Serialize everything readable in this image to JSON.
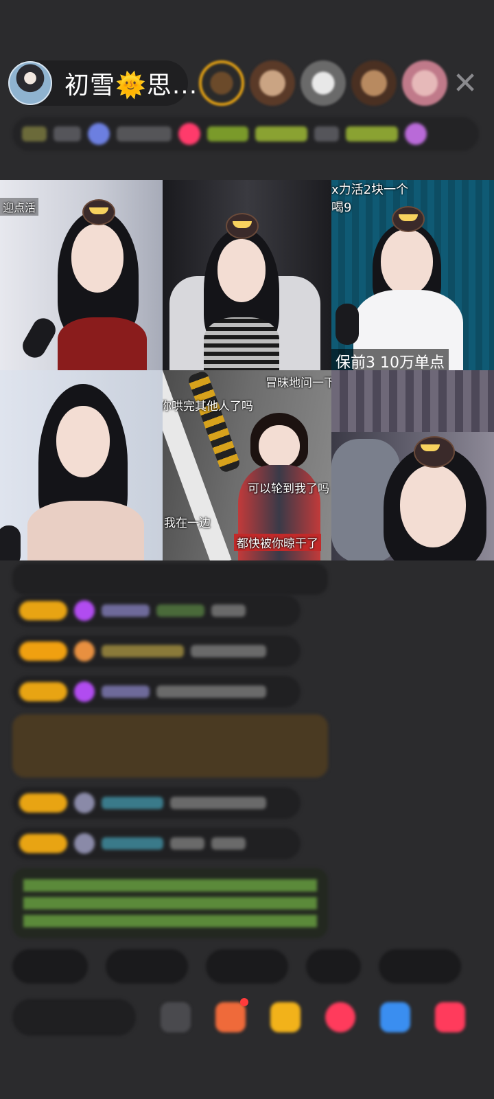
{
  "header": {
    "host_name": "初雪🌞思...",
    "close_icon": "close-icon"
  },
  "grid": {
    "tiles": [
      {
        "label": "迎点活"
      },
      {
        "label": ""
      },
      {
        "label": "x力活2块一个",
        "label2": "喝9",
        "label3": "保前3  10万单点"
      },
      {
        "label": ""
      },
      {
        "label": "冒昧地问一下",
        "sub1": "你哄完其他人了吗",
        "sub2": "可以轮到我了吗",
        "sub3": "我在一边",
        "sub4": "都快被你晾干了"
      },
      {
        "label": ""
      }
    ]
  },
  "colors": {
    "background": "#2b2b2d",
    "level_badge": "#e8a413",
    "gift_purple": "#b14cf0",
    "accent_red": "#ff3b5c"
  }
}
